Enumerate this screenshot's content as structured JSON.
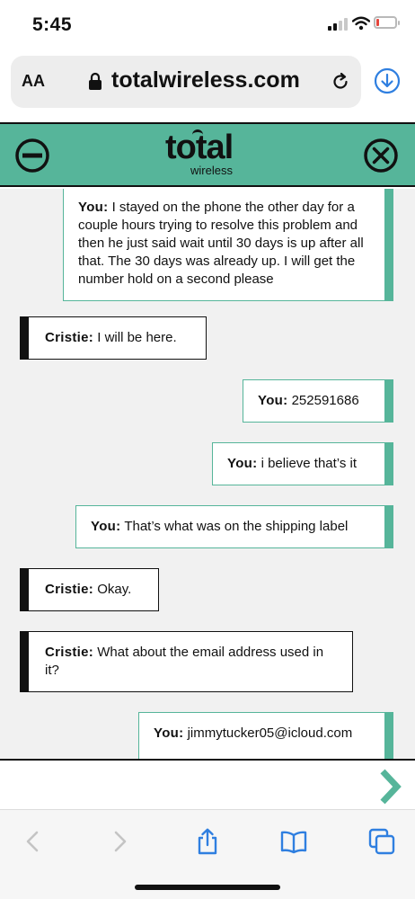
{
  "status_bar": {
    "time": "5:45",
    "battery_level": 0.15,
    "battery_color": "#e5453c"
  },
  "browser": {
    "text_size_label": "AA",
    "url": "totalwireless.com"
  },
  "chat_header": {
    "logo_main": "total",
    "logo_sub": "wireless",
    "accent_color": "#56b59a"
  },
  "messages": [
    {
      "sender": "You:",
      "text": " I stayed on the phone the other day for a couple hours trying to resolve this problem and then he just said wait until 30 days is up after all that. The 30 days was already up. I will get the number hold on a second please"
    },
    {
      "sender": "Cristie:",
      "text": " I will be here."
    },
    {
      "sender": "You:",
      "text": " 252591686"
    },
    {
      "sender": "You:",
      "text": " i believe that’s it"
    },
    {
      "sender": "You:",
      "text": " That’s what was on the shipping label"
    },
    {
      "sender": "Cristie:",
      "text": " Okay."
    },
    {
      "sender": "Cristie:",
      "text": " What about the email address used in it?"
    },
    {
      "sender": "You:",
      "text": " jimmytucker05@icloud.com"
    }
  ],
  "toolbar": {
    "icons": [
      "back-icon",
      "forward-icon",
      "share-icon",
      "bookmarks-icon",
      "tabs-icon"
    ]
  }
}
